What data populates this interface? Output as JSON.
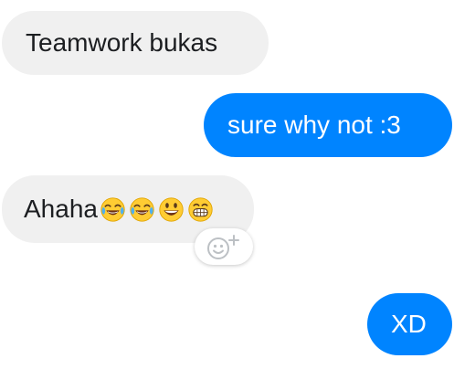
{
  "conversation": {
    "messages": [
      {
        "direction": "incoming",
        "text": "Teamwork bukas"
      },
      {
        "direction": "outgoing",
        "text": "sure why not :3"
      },
      {
        "direction": "incoming",
        "text": "Ahaha",
        "emojis": [
          "joy-emoji",
          "joy-emoji",
          "grinning-emoji",
          "grimacing-emoji"
        ]
      },
      {
        "direction": "outgoing",
        "text": "XD"
      }
    ],
    "reaction_button_icon": "smiley-plus-icon"
  },
  "colors": {
    "incoming_bubble": "#f0f0f0",
    "outgoing_bubble": "#0084ff",
    "incoming_text": "#1c1e21",
    "outgoing_text": "#ffffff"
  }
}
